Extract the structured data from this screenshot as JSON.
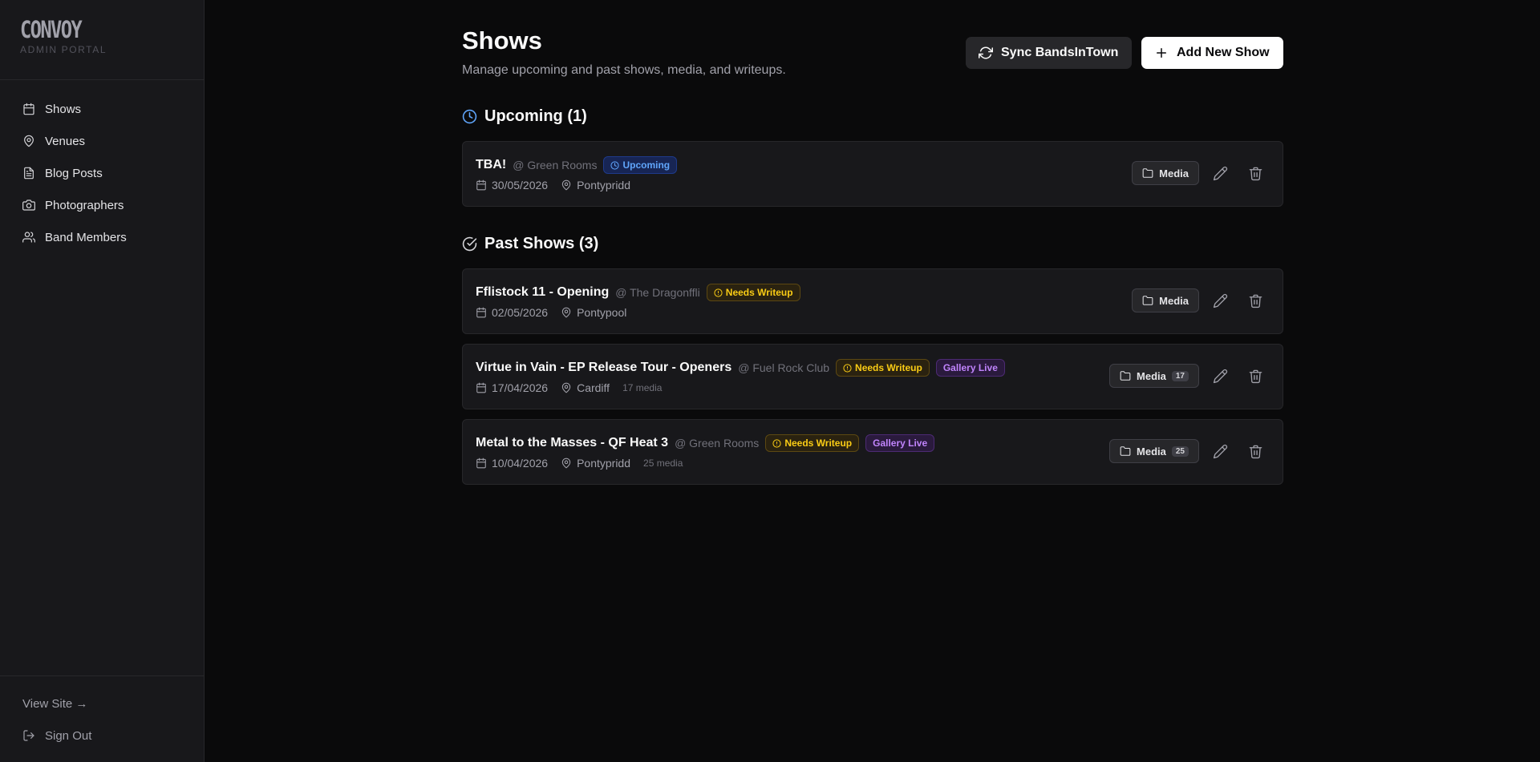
{
  "brand": {
    "logo": "CONVOY",
    "subtitle": "ADMIN PORTAL"
  },
  "sidebar": {
    "items": [
      {
        "label": "Shows",
        "icon": "calendar-icon"
      },
      {
        "label": "Venues",
        "icon": "map-pin-icon"
      },
      {
        "label": "Blog Posts",
        "icon": "file-text-icon"
      },
      {
        "label": "Photographers",
        "icon": "camera-icon"
      },
      {
        "label": "Band Members",
        "icon": "users-icon"
      }
    ],
    "view_site": "View Site →",
    "sign_out": "Sign Out"
  },
  "header": {
    "title": "Shows",
    "subtitle": "Manage upcoming and past shows, media, and writeups.",
    "sync_label": "Sync BandsInTown",
    "add_label": "Add New Show"
  },
  "upcoming": {
    "title": "Upcoming (1)",
    "shows": [
      {
        "name": "TBA!",
        "venue": "@ Green Rooms",
        "badge": "Upcoming",
        "date": "30/05/2026",
        "location": "Pontypridd",
        "media_label": "Media"
      }
    ]
  },
  "past": {
    "title": "Past Shows (3)",
    "shows": [
      {
        "name": "Fflistock 11 - Opening",
        "venue": "@ The Dragonffli",
        "writeup": "Needs Writeup",
        "date": "02/05/2026",
        "location": "Pontypool",
        "media_label": "Media"
      },
      {
        "name": "Virtue in Vain - EP Release Tour - Openers",
        "venue": "@ Fuel Rock Club",
        "writeup": "Needs Writeup",
        "gallery": "Gallery Live",
        "date": "17/04/2026",
        "location": "Cardiff",
        "media_text": "17 media",
        "media_label": "Media",
        "media_count": "17"
      },
      {
        "name": "Metal to the Masses - QF Heat 3",
        "venue": "@ Green Rooms",
        "writeup": "Needs Writeup",
        "gallery": "Gallery Live",
        "date": "10/04/2026",
        "location": "Pontypridd",
        "media_text": "25 media",
        "media_label": "Media",
        "media_count": "25"
      }
    ]
  },
  "colors": {
    "background": "#0a0a0b",
    "sidebar": "#18181b",
    "upcoming_accent": "#60a5fa",
    "writeup_accent": "#facc15",
    "gallery_accent": "#c084fc"
  }
}
